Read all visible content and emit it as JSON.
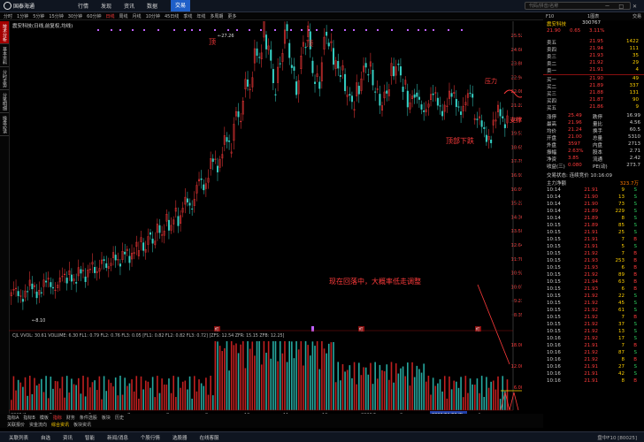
{
  "app": {
    "logo_text": "国泰海通",
    "logo_sub": "HAITONG"
  },
  "topmenu": {
    "items": [
      "行情",
      "发现",
      "资讯",
      "数据",
      "交易"
    ],
    "active_index": 4
  },
  "search": {
    "placeholder": "代码/拼音/名称"
  },
  "window_controls": "－ □ ✕",
  "periods": {
    "items": [
      "分时",
      "1分钟",
      "5分钟",
      "15分钟",
      "30分钟",
      "60分钟",
      "日线",
      "周线",
      "月线",
      "10分钟",
      "45日线",
      "季线",
      "年线",
      "多周期",
      "更多"
    ],
    "active": "日线"
  },
  "rightbar": {
    "items": [
      "F10",
      "1图表",
      "交易"
    ]
  },
  "sidebar": {
    "tabs": [
      "技术分析",
      "基本资料",
      "分时走势",
      "分笔明细",
      "操盘必读"
    ],
    "active_index": 0
  },
  "chart": {
    "title": "震安科技(日线,前复权,均线)",
    "price_axis": [
      "25.52",
      "24.66",
      "23.80",
      "22.94",
      "22.08",
      "21.22",
      "20.37",
      "19.51",
      "18.65",
      "17.79",
      "16.93",
      "16.07",
      "15.22",
      "14.36",
      "13.50",
      "12.64",
      "11.78",
      "10.92",
      "10.07",
      "9.21",
      "8.35"
    ],
    "high_label": "27.26",
    "low_label": "8.10",
    "annotations": {
      "peak1": "顶",
      "peak2": "顶",
      "lower_left": "顶部下跌",
      "resist": "压力",
      "support": "支撑",
      "note": "现在回落中，大概率低走调整"
    },
    "indicator_line": "CJL VVOL: 30.61 VOLUME: 6.30 FL1: 0.79 FL2: 0.76 FL3: 0.05 [FL1: 0.82 FL2: 0.82 FL3: 0.72] [ZFS: 12.54 ZFR: 15.15 ZFB: 12.25]",
    "vol_axis": [
      "18.00",
      "12.00",
      "6.00"
    ],
    "date_labels": [
      "2025/4",
      "5",
      "6",
      "7",
      "8",
      "9",
      "10",
      "11",
      "12",
      "2026/1",
      "2",
      "3",
      "4"
    ],
    "selected_date": "2026/01/09/五",
    "red_markers": [
      "红",
      "红",
      "红"
    ]
  },
  "bottombar": {
    "items": [
      "指标A",
      "指标B",
      "模板",
      "指标",
      "财务",
      "条件选股",
      "板块",
      "历史"
    ],
    "active": "指标"
  },
  "bottombar2": {
    "items": [
      "关联报价",
      "资金流向",
      "综合资讯",
      "板块资讯"
    ]
  },
  "quote": {
    "name": "震安科技",
    "code": "300767",
    "price": "21.90",
    "change": "0.65",
    "pct": "3.11%",
    "asks": [
      [
        "卖五",
        "21.95",
        "1422"
      ],
      [
        "卖四",
        "21.94",
        "111"
      ],
      [
        "卖三",
        "21.93",
        "35"
      ],
      [
        "卖二",
        "21.92",
        "29"
      ],
      [
        "卖一",
        "21.91",
        "4"
      ]
    ],
    "bids": [
      [
        "买一",
        "21.90",
        "49"
      ],
      [
        "买二",
        "21.89",
        "337"
      ],
      [
        "买三",
        "21.88",
        "131"
      ],
      [
        "买四",
        "21.87",
        "90"
      ],
      [
        "买五",
        "21.86",
        "9"
      ]
    ],
    "stats": [
      [
        "涨停",
        "25.49",
        "跌停",
        "16.99"
      ],
      [
        "最高",
        "21.96",
        "量比",
        "4.56"
      ],
      [
        "均价",
        "21.24",
        "换手",
        "60.5"
      ],
      [
        "开盘",
        "21.00",
        "总量",
        "5310"
      ],
      [
        "外盘",
        "3597",
        "内盘",
        "2713"
      ],
      [
        "振幅",
        "2.63%",
        "股本",
        "2.71"
      ],
      [
        "净资",
        "3.85",
        "流通",
        "2.42"
      ],
      [
        "收益(三)",
        "0.080",
        "PE(动)",
        "273.7"
      ]
    ],
    "trade_status": "交易状态: 连续竞价 10:16:09",
    "main_flow": "主力净额",
    "main_flow_value": "323.7万",
    "ticks": [
      [
        "10:14",
        "21.91",
        "9",
        "S"
      ],
      [
        "10:14",
        "21.90",
        "13",
        "S"
      ],
      [
        "10:14",
        "21.90",
        "73",
        "S"
      ],
      [
        "10:14",
        "21.89",
        "229",
        "S"
      ],
      [
        "10:14",
        "21.89",
        "8",
        "S"
      ],
      [
        "10:15",
        "21.89",
        "85",
        "S"
      ],
      [
        "10:15",
        "21.91",
        "25",
        "S"
      ],
      [
        "10:15",
        "21.91",
        "7",
        "B"
      ],
      [
        "10:15",
        "21.91",
        "5",
        "S"
      ],
      [
        "10:15",
        "21.92",
        "7",
        "B"
      ],
      [
        "10:15",
        "21.93",
        "253",
        "B"
      ],
      [
        "10:15",
        "21.93",
        "6",
        "B"
      ],
      [
        "10:15",
        "21.92",
        "89",
        "B"
      ],
      [
        "10:15",
        "21.94",
        "63",
        "B"
      ],
      [
        "10:15",
        "21.93",
        "6",
        "B"
      ],
      [
        "10:15",
        "21.92",
        "22",
        "S"
      ],
      [
        "10:15",
        "21.92",
        "45",
        "S"
      ],
      [
        "10:15",
        "21.92",
        "61",
        "S"
      ],
      [
        "10:15",
        "21.92",
        "7",
        "B"
      ],
      [
        "10:15",
        "21.92",
        "37",
        "S"
      ],
      [
        "10:15",
        "21.92",
        "13",
        "S"
      ],
      [
        "10:16",
        "21.92",
        "17",
        "S"
      ],
      [
        "10:16",
        "21.91",
        "7",
        "B"
      ],
      [
        "10:16",
        "21.92",
        "87",
        "S"
      ],
      [
        "10:16",
        "21.92",
        "8",
        "B"
      ],
      [
        "10:16",
        "21.91",
        "27",
        "S"
      ],
      [
        "10:16",
        "21.91",
        "42",
        "S"
      ],
      [
        "10:16",
        "21.91",
        "8",
        "B"
      ]
    ]
  },
  "statusbar": {
    "items": [
      "关联列表",
      "自选",
      "资讯",
      "智能",
      "新闻/消息",
      "个股行情",
      "选股器",
      "在线客服"
    ],
    "right": "盘中F10 [80025]"
  },
  "colors": {
    "up": "#ff3b3b",
    "down": "#36d3c7",
    "text": "#cccccc",
    "yellow": "#ffd000",
    "bg": "#000000",
    "purple": "#c060ff",
    "flow": "#ff7a00"
  }
}
